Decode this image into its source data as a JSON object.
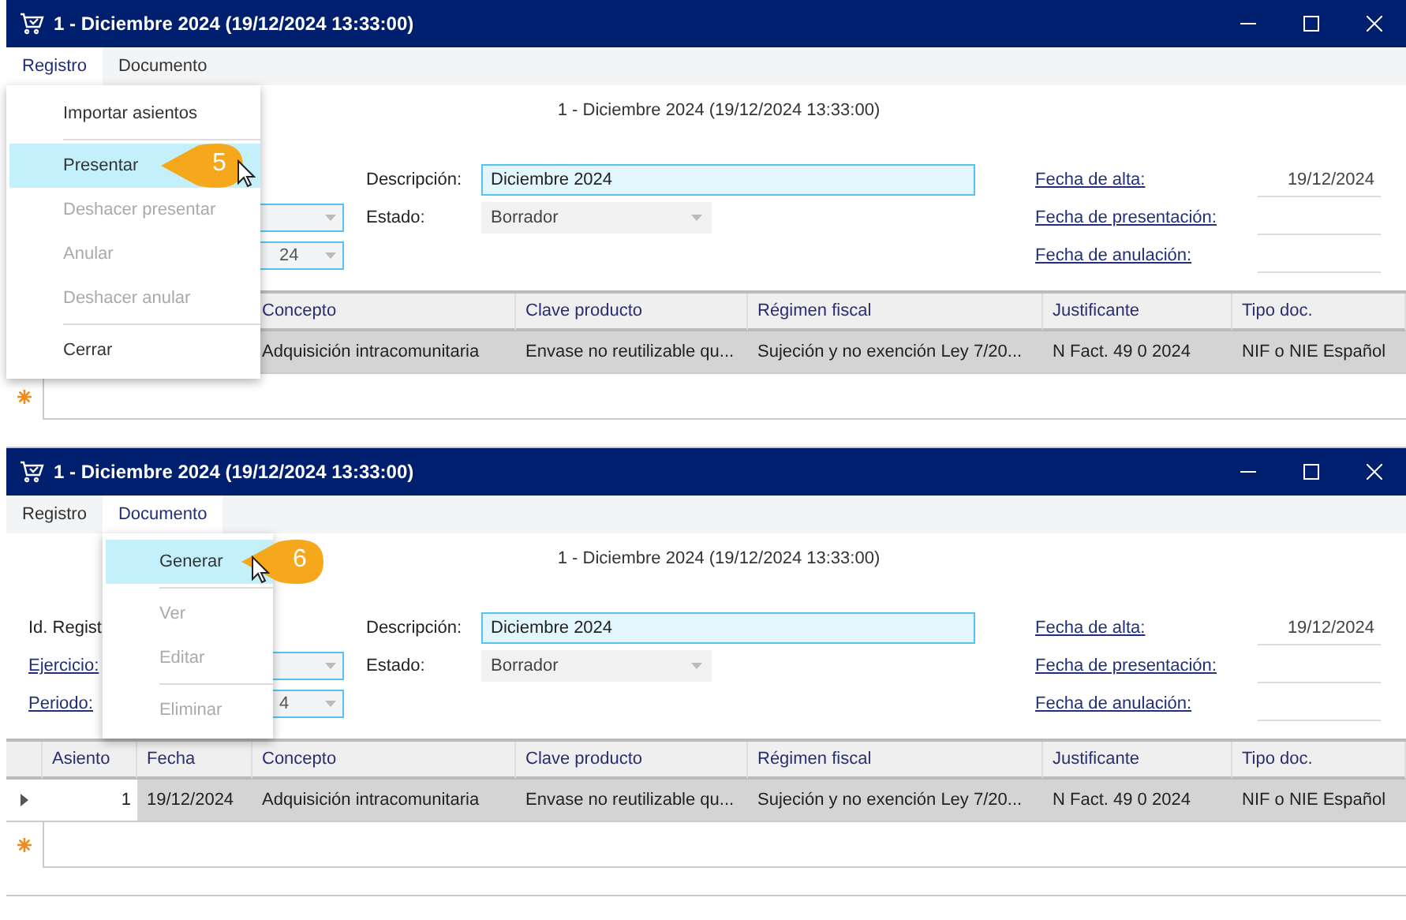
{
  "windows": [
    {
      "title": "1 - Diciembre 2024 (19/12/2024 13:33:00)",
      "menubar": [
        {
          "label": "Registro",
          "open": true
        },
        {
          "label": "Documento",
          "open": false
        }
      ],
      "menu": [
        {
          "kind": "item",
          "label": "Importar asientos",
          "disabled": false,
          "highlighted": false
        },
        {
          "kind": "separator"
        },
        {
          "kind": "item",
          "label": "Presentar",
          "disabled": false,
          "highlighted": true,
          "callout": "5"
        },
        {
          "kind": "item",
          "label": "Deshacer presentar",
          "disabled": true,
          "highlighted": false
        },
        {
          "kind": "item",
          "label": "Anular",
          "disabled": true,
          "highlighted": false
        },
        {
          "kind": "item",
          "label": "Deshacer anular",
          "disabled": true,
          "highlighted": false
        },
        {
          "kind": "separator"
        },
        {
          "kind": "item",
          "label": "Cerrar",
          "disabled": false,
          "highlighted": false
        }
      ],
      "header": "1 - Diciembre 2024 (19/12/2024 13:33:00)",
      "left_fields": [
        {
          "kind": "text"
        },
        {
          "kind": "select"
        },
        {
          "kind": "select",
          "value": "24"
        }
      ],
      "descripcion": {
        "label": "Descripción:",
        "value": "Diciembre 2024"
      },
      "estado": {
        "label": "Estado:",
        "value": "Borrador"
      },
      "dates": [
        {
          "label": "Fecha de alta:",
          "value": "19/12/2024"
        },
        {
          "label": "Fecha de presentación:"
        },
        {
          "label": "Fecha de anulación:"
        }
      ],
      "columns": [
        "Concepto",
        "Clave producto",
        "Régimen fiscal",
        "Justificante",
        "Tipo doc."
      ],
      "rows": [
        {
          "cells": [
            "Adquisición intracomunitaria",
            "Envase no reutilizable qu...",
            "Sujeción y no exención Ley 7/20...",
            "N Fact. 49 0 2024",
            "NIF o NIE Español"
          ]
        }
      ]
    },
    {
      "title": "1 - Diciembre 2024 (19/12/2024 13:33:00)",
      "menubar": [
        {
          "label": "Registro",
          "open": false
        },
        {
          "label": "Documento",
          "open": true
        }
      ],
      "menu": [
        {
          "kind": "item",
          "label": "Generar",
          "disabled": false,
          "highlighted": true,
          "callout": "6"
        },
        {
          "kind": "separator"
        },
        {
          "kind": "item",
          "label": "Ver",
          "disabled": true,
          "highlighted": false
        },
        {
          "kind": "item",
          "label": "Editar",
          "disabled": true,
          "highlighted": false
        },
        {
          "kind": "separator"
        },
        {
          "kind": "item",
          "label": "Eliminar",
          "disabled": true,
          "highlighted": false
        }
      ],
      "header": "1 - Diciembre 2024 (19/12/2024 13:33:00)",
      "left_fields": [
        {
          "kind": "text",
          "label": "Id. Regist",
          "link": false
        },
        {
          "kind": "select",
          "label": "Ejercicio:",
          "link": true
        },
        {
          "kind": "select",
          "label": "Periodo:",
          "link": true,
          "value": "4"
        }
      ],
      "descripcion": {
        "label": "Descripción:",
        "value": "Diciembre 2024"
      },
      "estado": {
        "label": "Estado:",
        "value": "Borrador"
      },
      "dates": [
        {
          "label": "Fecha de alta:",
          "value": "19/12/2024"
        },
        {
          "label": "Fecha de presentación:"
        },
        {
          "label": "Fecha de anulación:"
        }
      ],
      "columns": [
        "Asiento",
        "Fecha",
        "Concepto",
        "Clave producto",
        "Régimen fiscal",
        "Justificante",
        "Tipo doc."
      ],
      "rows": [
        {
          "current": true,
          "cells": [
            "1",
            "19/12/2024",
            "Adquisición intracomunitaria",
            "Envase no reutilizable qu...",
            "Sujeción y no exención Ley 7/20...",
            "N Fact. 49 0 2024",
            "NIF o NIE Español"
          ]
        }
      ]
    }
  ]
}
